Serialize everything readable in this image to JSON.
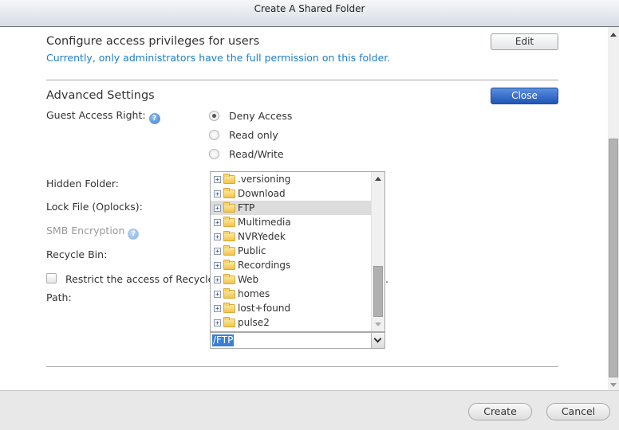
{
  "window": {
    "title": "Create A Shared Folder"
  },
  "access": {
    "title": "Configure access privileges for users",
    "info": "Currently, only administrators have the full permission on this folder.",
    "edit_label": "Edit"
  },
  "advanced": {
    "title": "Advanced Settings",
    "close_label": "Close",
    "guest_access_label": "Guest Access Right:",
    "guest_options": [
      {
        "label": "Deny Access",
        "checked": true
      },
      {
        "label": "Read only",
        "checked": false
      },
      {
        "label": "Read/Write",
        "checked": false
      }
    ],
    "hidden_folder_label": "Hidden Folder:",
    "lock_file_label": "Lock File (Oplocks):",
    "smb_encryption_label": "SMB Encryption",
    "recycle_bin_label": "Recycle Bin:",
    "restrict_label": "Restrict the access of Recycle",
    "restrict_tail": ".",
    "restrict_checked": false,
    "path_label": "Path:"
  },
  "path_picker": {
    "folders": [
      {
        "name": ".versioning",
        "selected": false
      },
      {
        "name": "Download",
        "selected": false
      },
      {
        "name": "FTP",
        "selected": true
      },
      {
        "name": "Multimedia",
        "selected": false
      },
      {
        "name": "NVRYedek",
        "selected": false
      },
      {
        "name": "Public",
        "selected": false
      },
      {
        "name": "Recordings",
        "selected": false
      },
      {
        "name": "Web",
        "selected": false
      },
      {
        "name": "homes",
        "selected": false
      },
      {
        "name": "lost+found",
        "selected": false
      },
      {
        "name": "pulse2",
        "selected": false
      }
    ],
    "expand_glyph": "+",
    "value": "/FTP"
  },
  "footer": {
    "create_label": "Create",
    "cancel_label": "Cancel"
  },
  "icons": {
    "help": "?"
  }
}
